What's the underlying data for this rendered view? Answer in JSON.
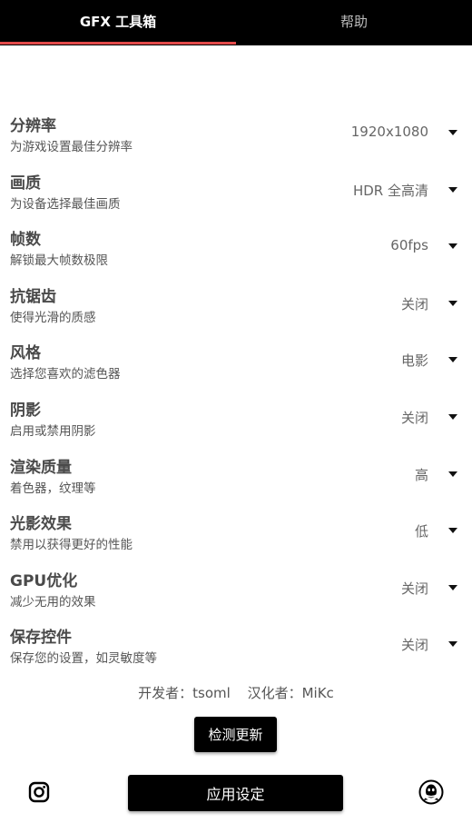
{
  "tabs": {
    "active_label": "GFX 工具箱",
    "inactive_label": "帮助",
    "indicator_color": "#e24a4a"
  },
  "settings": [
    {
      "title": "分辨率",
      "subtitle": "为游戏设置最佳分辨率",
      "value": "1920x1080"
    },
    {
      "title": "画质",
      "subtitle": "为设备选择最佳画质",
      "value": "HDR 全高清"
    },
    {
      "title": "帧数",
      "subtitle": "解锁最大帧数极限",
      "value": "60fps"
    },
    {
      "title": "抗锯齿",
      "subtitle": "使得光滑的质感",
      "value": "关闭"
    },
    {
      "title": "风格",
      "subtitle": "选择您喜欢的滤色器",
      "value": "电影"
    },
    {
      "title": "阴影",
      "subtitle": "启用或禁用阴影",
      "value": "关闭"
    },
    {
      "title": "渲染质量",
      "subtitle": "着色器，纹理等",
      "value": "高"
    },
    {
      "title": "光影效果",
      "subtitle": "禁用以获得更好的性能",
      "value": "低"
    },
    {
      "title": "GPU优化",
      "subtitle": "减少无用的效果",
      "value": "关闭"
    },
    {
      "title": "保存控件",
      "subtitle": "保存您的设置，如灵敏度等",
      "value": "关闭"
    }
  ],
  "credits": {
    "developer": "开发者：tsoml",
    "translator": "汉化者：MiKc"
  },
  "buttons": {
    "check_update": "检测更新",
    "apply": "应用设定"
  },
  "icons": {
    "left": "instagram-icon",
    "right": "qq-icon"
  }
}
